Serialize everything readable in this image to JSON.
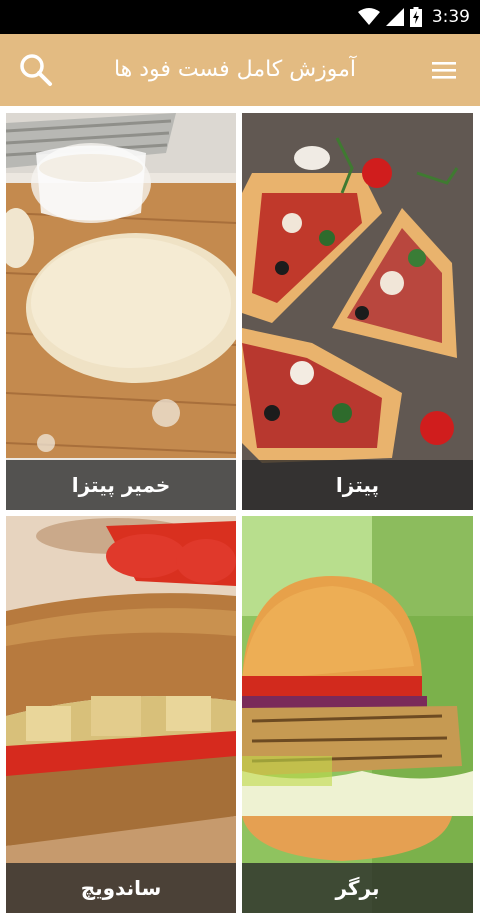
{
  "status_bar": {
    "time": "3:39"
  },
  "app_bar": {
    "title": "آموزش کامل فست فود ها"
  },
  "cards": [
    {
      "label": "پیتزا"
    },
    {
      "label": "خمیر پیتزا"
    },
    {
      "label": "برگر"
    },
    {
      "label": "ساندویچ"
    }
  ],
  "colors": {
    "app_bar": "#e3bb82",
    "status_bar": "#000000",
    "caption_overlay": "#282828"
  }
}
